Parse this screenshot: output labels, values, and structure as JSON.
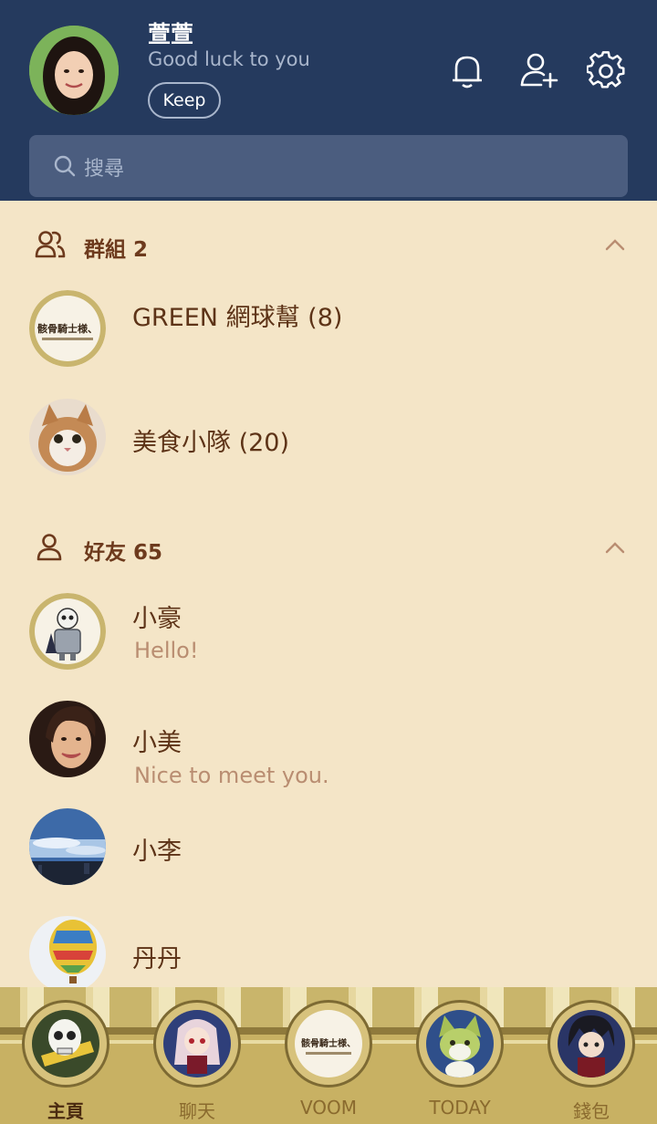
{
  "profile": {
    "name": "萱萱",
    "status": "Good luck to you",
    "keep_label": "Keep"
  },
  "header_icons": [
    "bell-icon",
    "add-friend-icon",
    "settings-icon"
  ],
  "search": {
    "placeholder": "搜尋"
  },
  "groups": {
    "label": "群組 2",
    "items": [
      {
        "name": "GREEN 網球幫 (8)",
        "avatar_text": "骸骨騎士様、"
      },
      {
        "name": "美食小隊 (20)"
      }
    ]
  },
  "friends": {
    "label": "好友 65",
    "items": [
      {
        "name": "小豪",
        "message": "Hello!"
      },
      {
        "name": "小美",
        "message": "Nice to meet you."
      },
      {
        "name": "小李"
      },
      {
        "name": "丹丹"
      }
    ]
  },
  "bottom_nav": [
    {
      "label": "主頁",
      "active": true
    },
    {
      "label": "聊天"
    },
    {
      "label": "VOOM",
      "medal_text": "骸骨騎士様、"
    },
    {
      "label": "TODAY"
    },
    {
      "label": "錢包"
    }
  ],
  "colors": {
    "header_bg": "#253a5e",
    "body_bg": "#f4e5c7",
    "section_text": "#6d3a1d",
    "nav_bg": "#c8b163"
  }
}
